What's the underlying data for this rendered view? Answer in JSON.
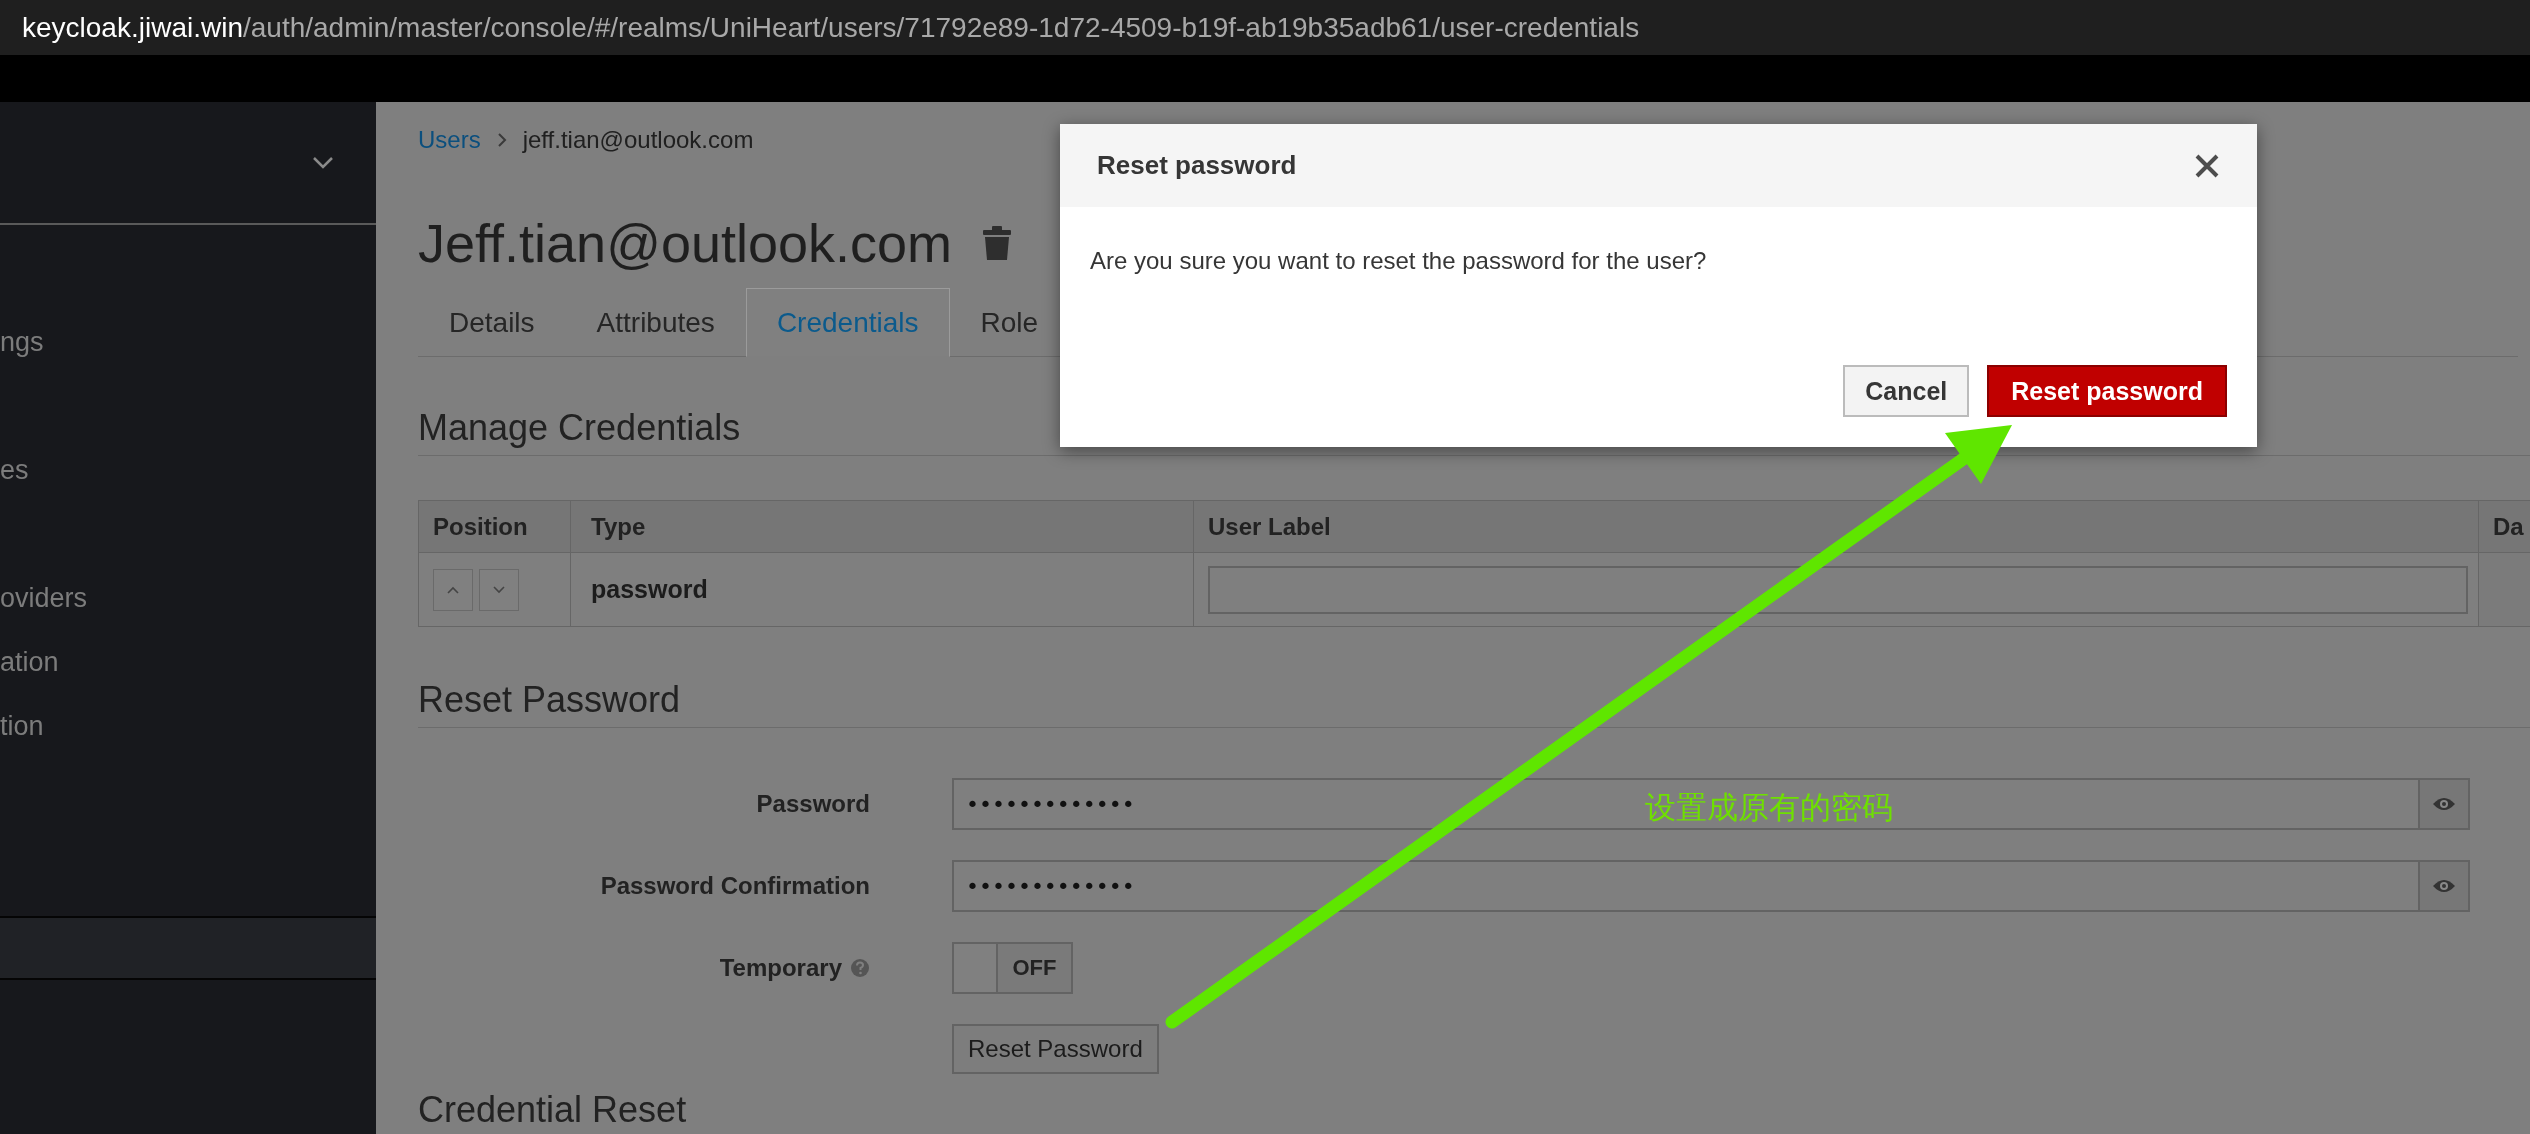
{
  "address_bar": {
    "host": "keycloak.jiwai.win",
    "path": "/auth/admin/master/console/#/realms/UniHeart/users/71792e89-1d72-4509-b19f-ab19b35adb61/user-credentials"
  },
  "sidebar": {
    "items": [
      {
        "label": "ngs"
      },
      {
        "label": "es"
      },
      {
        "label": "oviders"
      },
      {
        "label": "ation"
      },
      {
        "label": "tion"
      }
    ]
  },
  "breadcrumb": [
    {
      "label": "Users",
      "kind": "link"
    },
    {
      "label": "jeff.tian@outlook.com",
      "kind": "current"
    }
  ],
  "page_title": "Jeff.tian@outlook.com",
  "tabs": [
    {
      "label": "Details",
      "selected": false
    },
    {
      "label": "Attributes",
      "selected": false
    },
    {
      "label": "Credentials",
      "selected": true
    },
    {
      "label": "Role",
      "selected": false
    }
  ],
  "manage_credentials": {
    "heading": "Manage Credentials",
    "table": {
      "columns": [
        "Position",
        "Type",
        "User Label",
        "Da"
      ],
      "rows": [
        {
          "type": "password"
        }
      ]
    }
  },
  "reset_password": {
    "heading": "Reset Password",
    "fields": [
      {
        "label": "Password",
        "value": "•••••••••••••"
      },
      {
        "label": "Password Confirmation",
        "value": "•••••••••••••"
      }
    ],
    "temporary": {
      "label": "Temporary",
      "on": false,
      "state_text": "OFF"
    },
    "button": "Reset Password"
  },
  "credential_reset": {
    "heading": "Credential Reset"
  },
  "modal": {
    "title": "Reset password",
    "message": "Are you sure you want to reset the password for the user?",
    "buttons": [
      {
        "label": "Cancel",
        "kind": "secondary"
      },
      {
        "label": "Reset password",
        "kind": "primary"
      }
    ]
  },
  "annotation": {
    "text": "设置成原有的密码"
  }
}
